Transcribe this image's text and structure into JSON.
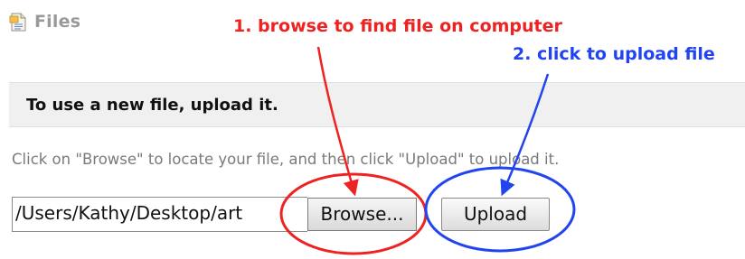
{
  "header": {
    "title": "Files",
    "icon": "files-icon"
  },
  "annotations": {
    "step_1": "1. browse to find file on computer",
    "step_2": "2. click to upload file",
    "step_1_color": "#ef2222",
    "step_2_color": "#2244ee"
  },
  "banner": {
    "text": "To use a new file, upload it."
  },
  "instructions": {
    "text": "Click on \"Browse\" to locate your file, and then click \"Upload\" to upload it."
  },
  "upload_form": {
    "file_path_value": "/Users/Kathy/Desktop/art",
    "browse_label": "Browse...",
    "upload_label": "Upload"
  }
}
